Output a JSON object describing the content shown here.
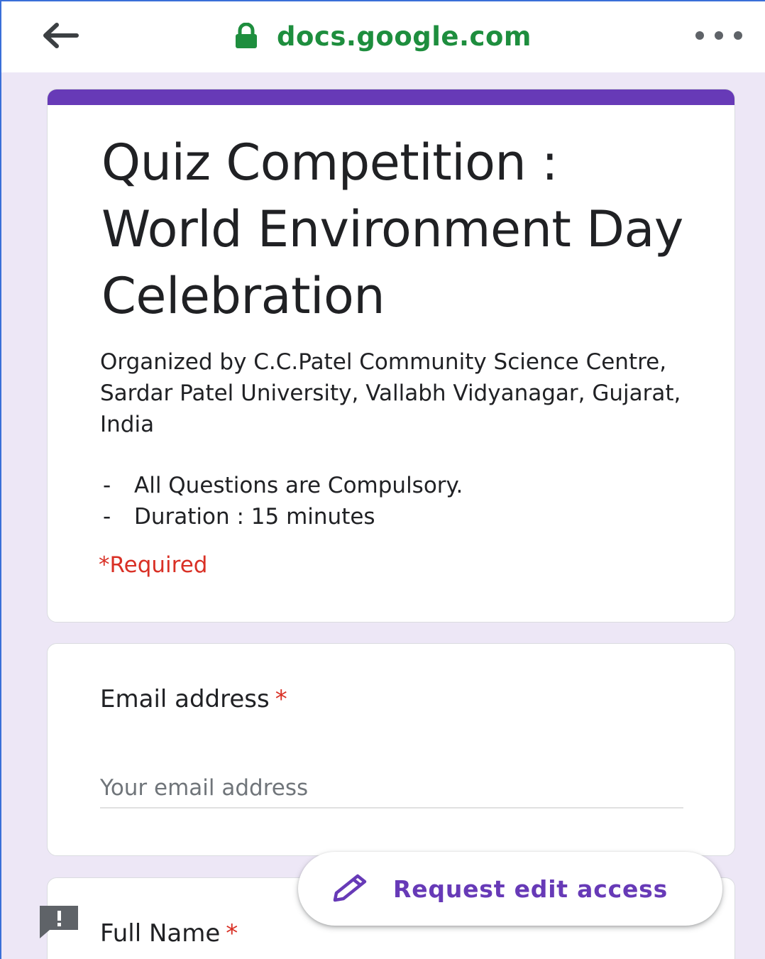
{
  "browser": {
    "url": "docs.google.com",
    "icons": {
      "back": "arrow-back-icon",
      "lock": "lock-icon",
      "menu": "more-horizontal-icon"
    }
  },
  "form": {
    "title": "Quiz Competition : World Environment Day Celebration",
    "description": "Organized by C.C.Patel Community Science Centre, Sardar Patel University, Vallabh Vidyanagar, Gujarat, India",
    "bullets": [
      "All Questions are Compulsory.",
      "Duration : 15 minutes"
    ],
    "bullet_marker": "-",
    "required_note": "*Required",
    "accent_color": "#673ab7"
  },
  "questions": [
    {
      "label": "Email address",
      "required_mark": "*",
      "placeholder": "Your email address"
    },
    {
      "label": "Full Name",
      "required_mark": "*"
    }
  ],
  "fab": {
    "label": "Request edit access",
    "icon": "pencil-icon"
  },
  "feedback": {
    "icon": "feedback-icon"
  }
}
